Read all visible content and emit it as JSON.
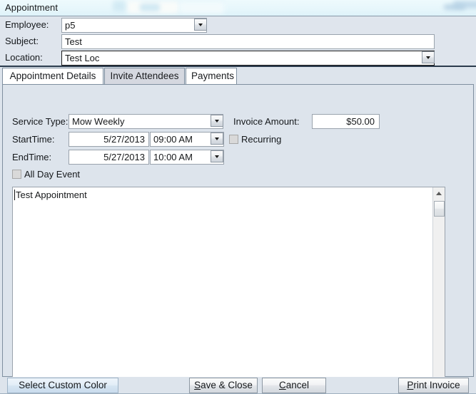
{
  "window": {
    "title": "Appointment"
  },
  "header": {
    "fields": [
      {
        "label": "Employee:",
        "value": "p5",
        "type": "combobox"
      },
      {
        "label": "Subject:",
        "value": "Test",
        "type": "textbox"
      },
      {
        "label": "Location:",
        "value": "Test Loc",
        "type": "combobox"
      }
    ]
  },
  "tabs": [
    {
      "label": "Appointment Details",
      "state": "selected"
    },
    {
      "label": "Invite Attendees",
      "state": "hover"
    },
    {
      "label": "Payments",
      "state": "normal"
    }
  ],
  "form": {
    "service_type": {
      "label": "Service Type:",
      "value": "Mow Weekly"
    },
    "invoice_amount": {
      "label": "Invoice Amount:",
      "value": "$50.00"
    },
    "start_time": {
      "label": "StartTime:",
      "date": "5/27/2013",
      "time": "09:00 AM"
    },
    "end_time": {
      "label": "EndTime:",
      "date": "5/27/2013",
      "time": "10:00 AM"
    },
    "recurring": {
      "label": "Recurring",
      "checked": false
    },
    "all_day_event": {
      "label": "All Day Event",
      "checked": false
    },
    "notes": {
      "value": "Test Appointment"
    }
  },
  "buttons": {
    "select_custom_color": "Select Custom Color",
    "save_and_close": {
      "accel": "S",
      "rest": "ave & Close"
    },
    "cancel": {
      "accel": "C",
      "rest": "ancel"
    },
    "print_invoice": {
      "accel": "P",
      "rest": "rint Invoice"
    }
  },
  "colors": {
    "form_background": "#dde4ec",
    "desktop_background": "#eaf7fb",
    "field_background": "#ffffff",
    "tab_hover": "#d5d8e0",
    "custom_color_button": "#dceaf6"
  }
}
